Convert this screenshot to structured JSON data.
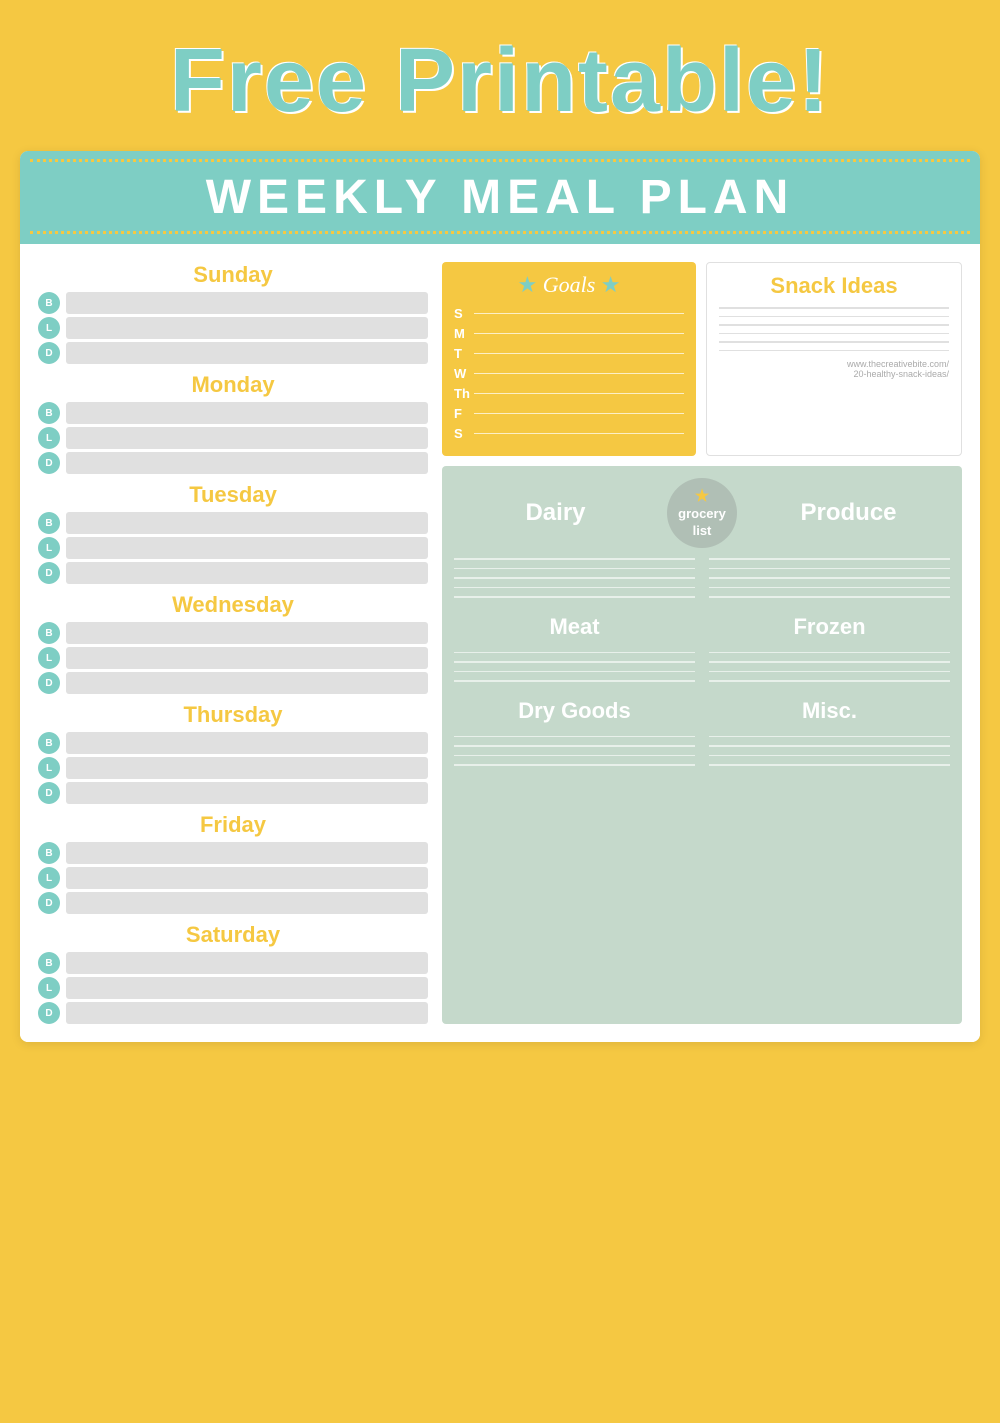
{
  "page": {
    "title": "Free Printable!",
    "background_color": "#f5c842"
  },
  "header": {
    "title": "WEEKLY MEAL PLAN",
    "bg_color": "#7ecec4"
  },
  "days": [
    {
      "name": "Sunday",
      "meals": [
        "B",
        "L",
        "D"
      ]
    },
    {
      "name": "Monday",
      "meals": [
        "B",
        "L",
        "D"
      ]
    },
    {
      "name": "Tuesday",
      "meals": [
        "B",
        "L",
        "D"
      ]
    },
    {
      "name": "Wednesday",
      "meals": [
        "B",
        "L",
        "D"
      ]
    },
    {
      "name": "Thursday",
      "meals": [
        "B",
        "L",
        "D"
      ]
    },
    {
      "name": "Friday",
      "meals": [
        "B",
        "L",
        "D"
      ]
    },
    {
      "name": "Saturday",
      "meals": [
        "B",
        "L",
        "D"
      ]
    }
  ],
  "goals": {
    "title": "Goals",
    "days": [
      "S",
      "M",
      "T",
      "W",
      "Th",
      "F",
      "S"
    ]
  },
  "snack_ideas": {
    "title": "Snack Ideas",
    "url": "www.thecreativebite.com/\n20-healthy-snack-ideas/",
    "line_count": 6
  },
  "grocery": {
    "badge_star": "★",
    "badge_line1": "grocery",
    "badge_line2": "list",
    "categories": [
      {
        "name": "Dairy",
        "lines": 5
      },
      {
        "name": "Produce",
        "lines": 5
      },
      {
        "name": "Meat",
        "lines": 4
      },
      {
        "name": "Frozen",
        "lines": 4
      },
      {
        "name": "Dry Goods",
        "lines": 4
      },
      {
        "name": "Misc.",
        "lines": 4
      }
    ]
  }
}
